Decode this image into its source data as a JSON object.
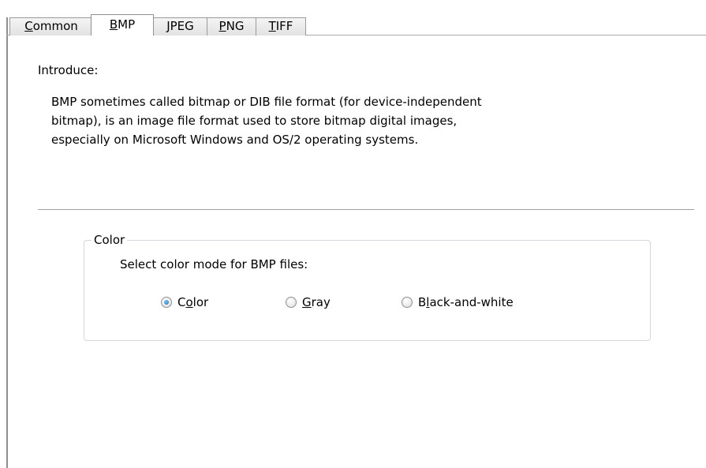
{
  "tabs": [
    {
      "label": "Common",
      "mnemonic_index": 0
    },
    {
      "label": "BMP",
      "mnemonic_index": 0
    },
    {
      "label": "JPEG",
      "mnemonic_index": 0
    },
    {
      "label": "PNG",
      "mnemonic_index": 0
    },
    {
      "label": "TIFF",
      "mnemonic_index": 0
    }
  ],
  "active_tab": "BMP",
  "intro": {
    "label": "Introduce:",
    "text_line1": "BMP sometimes called bitmap or DIB file format (for device-independent",
    "text_line2": "bitmap), is an image file format used to store bitmap digital images,",
    "text_line3": "especially on Microsoft Windows and OS/2 operating systems."
  },
  "color_group": {
    "title": "Color",
    "description": "Select color mode for BMP files:",
    "options": [
      {
        "label": "Color",
        "mnemonic_index": 1,
        "checked": true
      },
      {
        "label": "Gray",
        "mnemonic_index": 0,
        "checked": false
      },
      {
        "label": "Black-and-white",
        "mnemonic_index": 1,
        "checked": false
      }
    ]
  },
  "colors": {
    "radio_checked": "#1d6fb4",
    "border": "#8f8f8f",
    "groupbox_border": "#d3d8e0"
  }
}
